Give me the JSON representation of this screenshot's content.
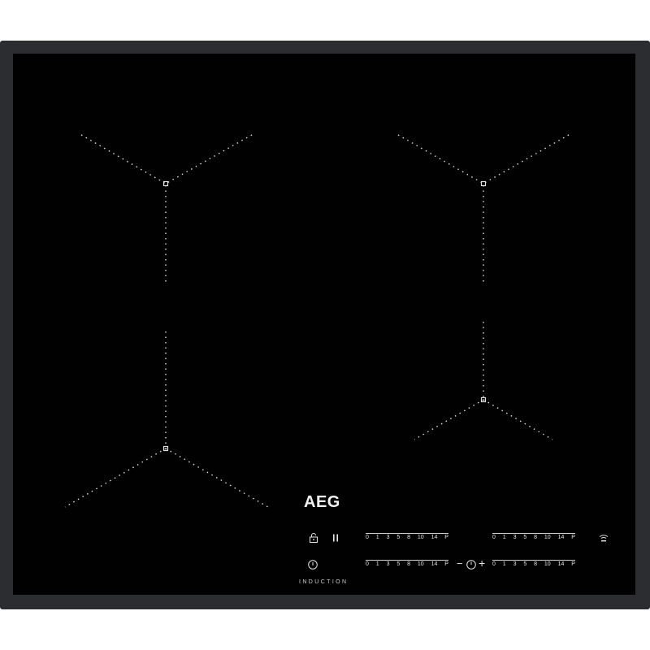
{
  "brand": {
    "logo": "AEG",
    "label": "INDUCTION"
  },
  "controls": {
    "lock_icon": "lock-icon",
    "pause_icon": "pause-icon",
    "power_icon": "power-icon",
    "timer": {
      "minus": "−",
      "plus": "+",
      "icon": "timer-icon"
    },
    "wifi_icon": "wifi-icon"
  },
  "sliders": [
    {
      "id": "front-left",
      "ticks": [
        "0",
        "1",
        "3",
        "5",
        "8",
        "10",
        "14",
        "P"
      ]
    },
    {
      "id": "rear-right",
      "ticks": [
        "0",
        "1",
        "3",
        "5",
        "8",
        "10",
        "14",
        "P"
      ]
    },
    {
      "id": "rear-left",
      "ticks": [
        "0",
        "1",
        "3",
        "5",
        "8",
        "10",
        "14",
        "P"
      ]
    },
    {
      "id": "front-right",
      "ticks": [
        "0",
        "1",
        "3",
        "5",
        "8",
        "10",
        "14",
        "P"
      ]
    }
  ],
  "colors": {
    "glass": "#010101",
    "frame": "#2b2d30",
    "marking": "#e0e0e0"
  }
}
